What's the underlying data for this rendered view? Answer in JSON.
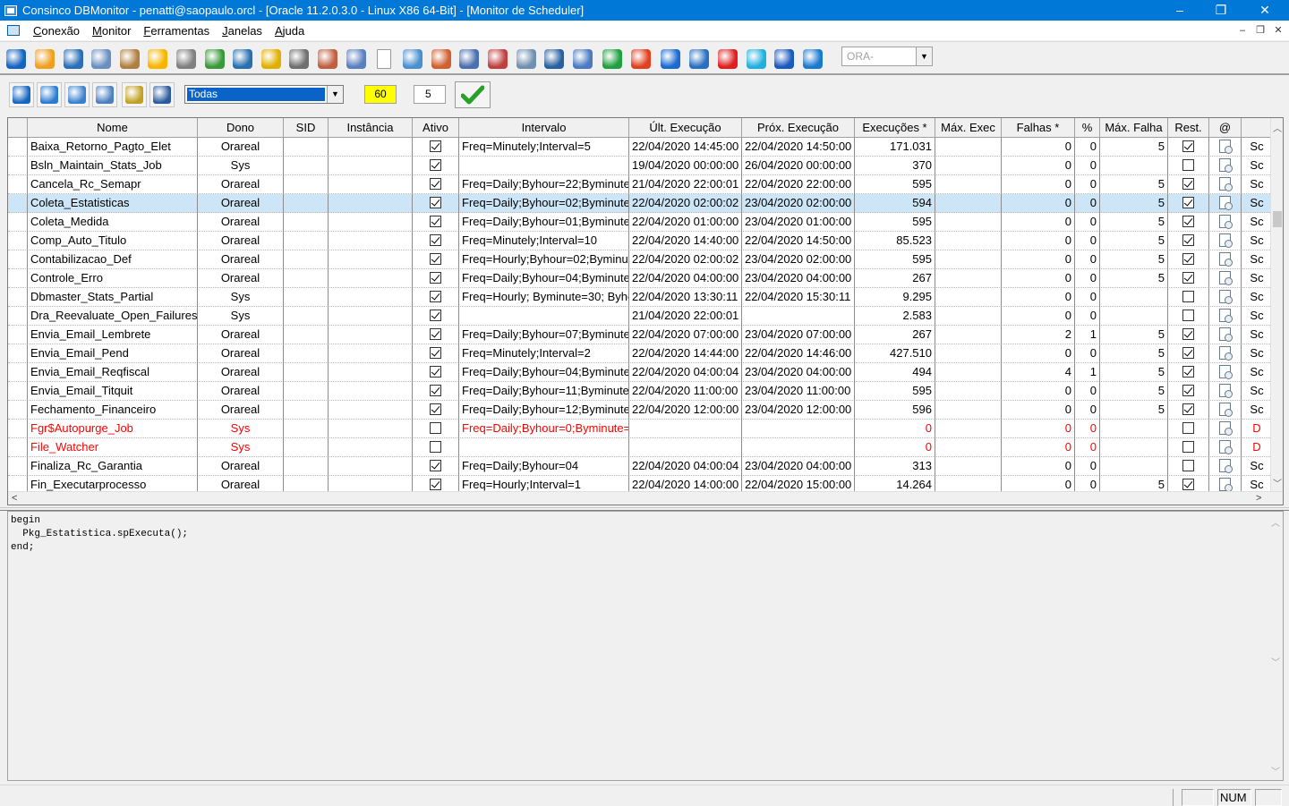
{
  "window": {
    "title": "Consinco DBMonitor - penatti@saopaulo.orcl - [Oracle 11.2.0.3.0 - Linux X86 64-Bit] - [Monitor de Scheduler]",
    "controls": [
      "–",
      "❐",
      "✕"
    ]
  },
  "menu": {
    "items": [
      "Conexão",
      "Monitor",
      "Ferramentas",
      "Janelas",
      "Ajuda"
    ],
    "mdi_controls": [
      "–",
      "❐",
      "✕"
    ]
  },
  "toolbar": {
    "connection_combo_placeholder": "ORA-",
    "icons": [
      "exit-icon",
      "key-icon",
      "search-icon",
      "user-icon",
      "lock-icon",
      "star-icon",
      "glasses-icon",
      "tree-icon",
      "hook-icon",
      "clock-icon",
      "database-icon",
      "users-icon",
      "copy-icon",
      "blank-page-icon",
      "preview-icon",
      "report-icon",
      "calendar-icon",
      "calendar-grid-icon",
      "list-icon",
      "monitor-icon",
      "people-icon",
      "area-chart-icon",
      "alarm-icon",
      "info-icon",
      "table-icon",
      "stop-icon",
      "asterisk-icon",
      "back-icon",
      "tag-icon"
    ],
    "colors": [
      "#1565c0",
      "#f0a020",
      "#2a6fb8",
      "#6a8fc0",
      "#b08040",
      "#f7b500",
      "#808080",
      "#3a9a3a",
      "#2a70b0",
      "#e0b000",
      "#707070",
      "#c06040",
      "#5a80c0",
      "#ffffff",
      "#4a90d0",
      "#d06030",
      "#4a70b0",
      "#c04040",
      "#7090b0",
      "#2a60a0",
      "#4a7ac0",
      "#20a040",
      "#e04020",
      "#1a6ad0",
      "#2a70c0",
      "#e02020",
      "#20b0e0",
      "#1a5ac0",
      "#1a7ad0"
    ]
  },
  "filters": {
    "scheduler_filter": "Todas",
    "refresh_interval": "60",
    "count_value": "5",
    "icons": [
      "exit-icon",
      "refresh-icon",
      "gear-icon",
      "export-icon",
      "calendar-filter-icon",
      "grid-icon"
    ]
  },
  "grid": {
    "headers": [
      "Nome",
      "Dono",
      "SID",
      "Instância",
      "Ativo",
      "Intervalo",
      "Últ. Execução",
      "Próx. Execução",
      "Execuções *",
      "Máx. Exec",
      "Falhas *",
      "%",
      "Máx. Falha",
      "Rest.",
      "@",
      ""
    ],
    "rows": [
      {
        "nome": "Baixa_Retorno_Pagto_Elet",
        "dono": "Orareal",
        "sid": "",
        "inst": "",
        "ativo": true,
        "intervalo": "Freq=Minutely;Interval=5",
        "ult": "22/04/2020 14:45:00",
        "prox": "22/04/2020 14:50:00",
        "exec": "171.031",
        "maxexec": "",
        "falhas": "0",
        "pct": "0",
        "maxfalha": "5",
        "rest": true,
        "last": "Sc",
        "state": ""
      },
      {
        "nome": "Bsln_Maintain_Stats_Job",
        "dono": "Sys",
        "sid": "",
        "inst": "",
        "ativo": true,
        "intervalo": "",
        "ult": "19/04/2020 00:00:00",
        "prox": "26/04/2020 00:00:00",
        "exec": "370",
        "maxexec": "",
        "falhas": "0",
        "pct": "0",
        "maxfalha": "",
        "rest": false,
        "last": "Sc",
        "state": ""
      },
      {
        "nome": "Cancela_Rc_Semapr",
        "dono": "Orareal",
        "sid": "",
        "inst": "",
        "ativo": true,
        "intervalo": "Freq=Daily;Byhour=22;Byminute",
        "ult": "21/04/2020 22:00:01",
        "prox": "22/04/2020 22:00:00",
        "exec": "595",
        "maxexec": "",
        "falhas": "0",
        "pct": "0",
        "maxfalha": "5",
        "rest": true,
        "last": "Sc",
        "state": ""
      },
      {
        "nome": "Coleta_Estatisticas",
        "dono": "Orareal",
        "sid": "",
        "inst": "",
        "ativo": true,
        "intervalo": "Freq=Daily;Byhour=02;Byminute",
        "ult": "22/04/2020 02:00:02",
        "prox": "23/04/2020 02:00:00",
        "exec": "594",
        "maxexec": "",
        "falhas": "0",
        "pct": "0",
        "maxfalha": "5",
        "rest": true,
        "last": "Sc",
        "state": "selected"
      },
      {
        "nome": "Coleta_Medida",
        "dono": "Orareal",
        "sid": "",
        "inst": "",
        "ativo": true,
        "intervalo": "Freq=Daily;Byhour=01;Byminute",
        "ult": "22/04/2020 01:00:00",
        "prox": "23/04/2020 01:00:00",
        "exec": "595",
        "maxexec": "",
        "falhas": "0",
        "pct": "0",
        "maxfalha": "5",
        "rest": true,
        "last": "Sc",
        "state": ""
      },
      {
        "nome": "Comp_Auto_Titulo",
        "dono": "Orareal",
        "sid": "",
        "inst": "",
        "ativo": true,
        "intervalo": "Freq=Minutely;Interval=10",
        "ult": "22/04/2020 14:40:00",
        "prox": "22/04/2020 14:50:00",
        "exec": "85.523",
        "maxexec": "",
        "falhas": "0",
        "pct": "0",
        "maxfalha": "5",
        "rest": true,
        "last": "Sc",
        "state": ""
      },
      {
        "nome": "Contabilizacao_Def",
        "dono": "Orareal",
        "sid": "",
        "inst": "",
        "ativo": true,
        "intervalo": "Freq=Hourly;Byhour=02;Byminut",
        "ult": "22/04/2020 02:00:02",
        "prox": "23/04/2020 02:00:00",
        "exec": "595",
        "maxexec": "",
        "falhas": "0",
        "pct": "0",
        "maxfalha": "5",
        "rest": true,
        "last": "Sc",
        "state": ""
      },
      {
        "nome": "Controle_Erro",
        "dono": "Orareal",
        "sid": "",
        "inst": "",
        "ativo": true,
        "intervalo": "Freq=Daily;Byhour=04;Byminute",
        "ult": "22/04/2020 04:00:00",
        "prox": "23/04/2020 04:00:00",
        "exec": "267",
        "maxexec": "",
        "falhas": "0",
        "pct": "0",
        "maxfalha": "5",
        "rest": true,
        "last": "Sc",
        "state": ""
      },
      {
        "nome": "Dbmaster_Stats_Partial",
        "dono": "Sys",
        "sid": "",
        "inst": "",
        "ativo": true,
        "intervalo": "Freq=Hourly; Byminute=30; Byhc",
        "ult": "22/04/2020 13:30:11",
        "prox": "22/04/2020 15:30:11",
        "exec": "9.295",
        "maxexec": "",
        "falhas": "0",
        "pct": "0",
        "maxfalha": "",
        "rest": false,
        "last": "Sc",
        "state": ""
      },
      {
        "nome": "Dra_Reevaluate_Open_Failures",
        "dono": "Sys",
        "sid": "",
        "inst": "",
        "ativo": true,
        "intervalo": "",
        "ult": "21/04/2020 22:00:01",
        "prox": "",
        "exec": "2.583",
        "maxexec": "",
        "falhas": "0",
        "pct": "0",
        "maxfalha": "",
        "rest": false,
        "last": "Sc",
        "state": ""
      },
      {
        "nome": "Envia_Email_Lembrete",
        "dono": "Orareal",
        "sid": "",
        "inst": "",
        "ativo": true,
        "intervalo": "Freq=Daily;Byhour=07;Byminute",
        "ult": "22/04/2020 07:00:00",
        "prox": "23/04/2020 07:00:00",
        "exec": "267",
        "maxexec": "",
        "falhas": "2",
        "pct": "1",
        "maxfalha": "5",
        "rest": true,
        "last": "Sc",
        "state": ""
      },
      {
        "nome": "Envia_Email_Pend",
        "dono": "Orareal",
        "sid": "",
        "inst": "",
        "ativo": true,
        "intervalo": "Freq=Minutely;Interval=2",
        "ult": "22/04/2020 14:44:00",
        "prox": "22/04/2020 14:46:00",
        "exec": "427.510",
        "maxexec": "",
        "falhas": "0",
        "pct": "0",
        "maxfalha": "5",
        "rest": true,
        "last": "Sc",
        "state": ""
      },
      {
        "nome": "Envia_Email_Reqfiscal",
        "dono": "Orareal",
        "sid": "",
        "inst": "",
        "ativo": true,
        "intervalo": "Freq=Daily;Byhour=04;Byminute",
        "ult": "22/04/2020 04:00:04",
        "prox": "23/04/2020 04:00:00",
        "exec": "494",
        "maxexec": "",
        "falhas": "4",
        "pct": "1",
        "maxfalha": "5",
        "rest": true,
        "last": "Sc",
        "state": ""
      },
      {
        "nome": "Envia_Email_Titquit",
        "dono": "Orareal",
        "sid": "",
        "inst": "",
        "ativo": true,
        "intervalo": "Freq=Daily;Byhour=11;Byminute",
        "ult": "22/04/2020 11:00:00",
        "prox": "23/04/2020 11:00:00",
        "exec": "595",
        "maxexec": "",
        "falhas": "0",
        "pct": "0",
        "maxfalha": "5",
        "rest": true,
        "last": "Sc",
        "state": ""
      },
      {
        "nome": "Fechamento_Financeiro",
        "dono": "Orareal",
        "sid": "",
        "inst": "",
        "ativo": true,
        "intervalo": "Freq=Daily;Byhour=12;Byminute",
        "ult": "22/04/2020 12:00:00",
        "prox": "23/04/2020 12:00:00",
        "exec": "596",
        "maxexec": "",
        "falhas": "0",
        "pct": "0",
        "maxfalha": "5",
        "rest": true,
        "last": "Sc",
        "state": ""
      },
      {
        "nome": "Fgr$Autopurge_Job",
        "dono": "Sys",
        "sid": "",
        "inst": "",
        "ativo": false,
        "intervalo": "Freq=Daily;Byhour=0;Byminute=",
        "ult": "",
        "prox": "",
        "exec": "0",
        "maxexec": "",
        "falhas": "0",
        "pct": "0",
        "maxfalha": "",
        "rest": false,
        "last": "D",
        "state": "inactive"
      },
      {
        "nome": "File_Watcher",
        "dono": "Sys",
        "sid": "",
        "inst": "",
        "ativo": false,
        "intervalo": "",
        "ult": "",
        "prox": "",
        "exec": "0",
        "maxexec": "",
        "falhas": "0",
        "pct": "0",
        "maxfalha": "",
        "rest": false,
        "last": "D",
        "state": "inactive"
      },
      {
        "nome": "Finaliza_Rc_Garantia",
        "dono": "Orareal",
        "sid": "",
        "inst": "",
        "ativo": true,
        "intervalo": "Freq=Daily;Byhour=04",
        "ult": "22/04/2020 04:00:04",
        "prox": "23/04/2020 04:00:00",
        "exec": "313",
        "maxexec": "",
        "falhas": "0",
        "pct": "0",
        "maxfalha": "",
        "rest": false,
        "last": "Sc",
        "state": ""
      },
      {
        "nome": "Fin_Executarprocesso",
        "dono": "Orareal",
        "sid": "",
        "inst": "",
        "ativo": true,
        "intervalo": "Freq=Hourly;Interval=1",
        "ult": "22/04/2020 14:00:00",
        "prox": "22/04/2020 15:00:00",
        "exec": "14.264",
        "maxexec": "",
        "falhas": "0",
        "pct": "0",
        "maxfalha": "5",
        "rest": true,
        "last": "Sc",
        "state": ""
      }
    ]
  },
  "editor": {
    "code": "begin\n  Pkg_Estatistica.spExecuta();\nend;"
  },
  "status": {
    "num": "NUM"
  },
  "accent": "#0078d7",
  "selection": "#cde6f7",
  "inactive_color": "#ff0000"
}
